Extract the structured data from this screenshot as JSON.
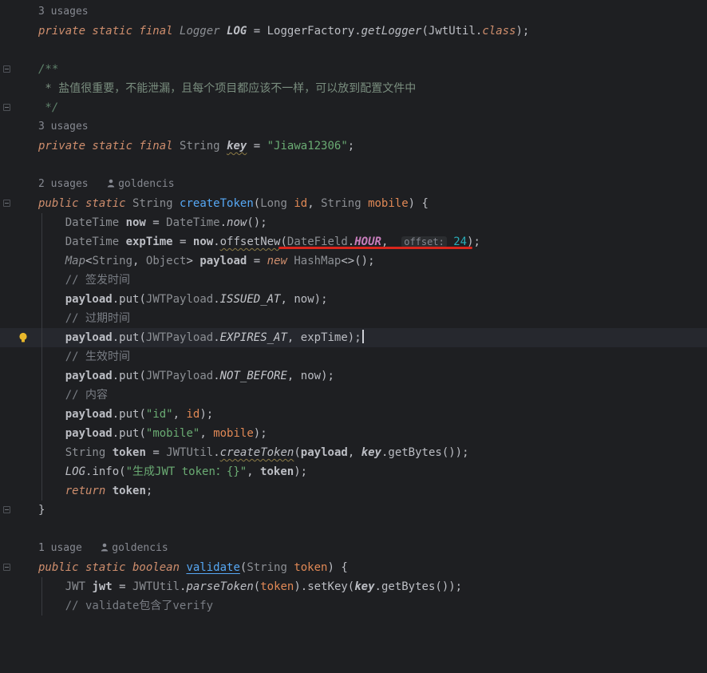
{
  "editor": {
    "file_class": "JwtUtil",
    "usages": {
      "log": "3 usages",
      "key": "3 usages",
      "createToken": "2 usages",
      "validate": "1 usage"
    },
    "author": "goldencis",
    "javadoc": {
      "open": "/**",
      "body": " * 盐值很重要，不能泄漏，且每个项目都应该不一样，可以放到配置文件中",
      "close": " */"
    },
    "key_value": "\"Jiawa12306\"",
    "hint_offset": "offset:",
    "offset_value": "24",
    "comments": {
      "issued": "// 签发时间",
      "expires": "// 过期时间",
      "not_before": "// 生效时间",
      "content": "// 内容",
      "partial": "// validate包含了verify"
    },
    "strings": {
      "id": "\"id\"",
      "mobile": "\"mobile\"",
      "log_msg": "\"生成JWT token：{}\""
    }
  },
  "colors": {
    "background": "#1e1f22",
    "current_line": "#26282e",
    "annotation_underline": "#d9261c",
    "keyword": "#cf8e6d",
    "string": "#6aab73",
    "number": "#2aacb8",
    "function": "#56a8f5",
    "field": "#c77dbb"
  },
  "icons": [
    "fold-icon",
    "bulb-icon",
    "author-icon"
  ]
}
